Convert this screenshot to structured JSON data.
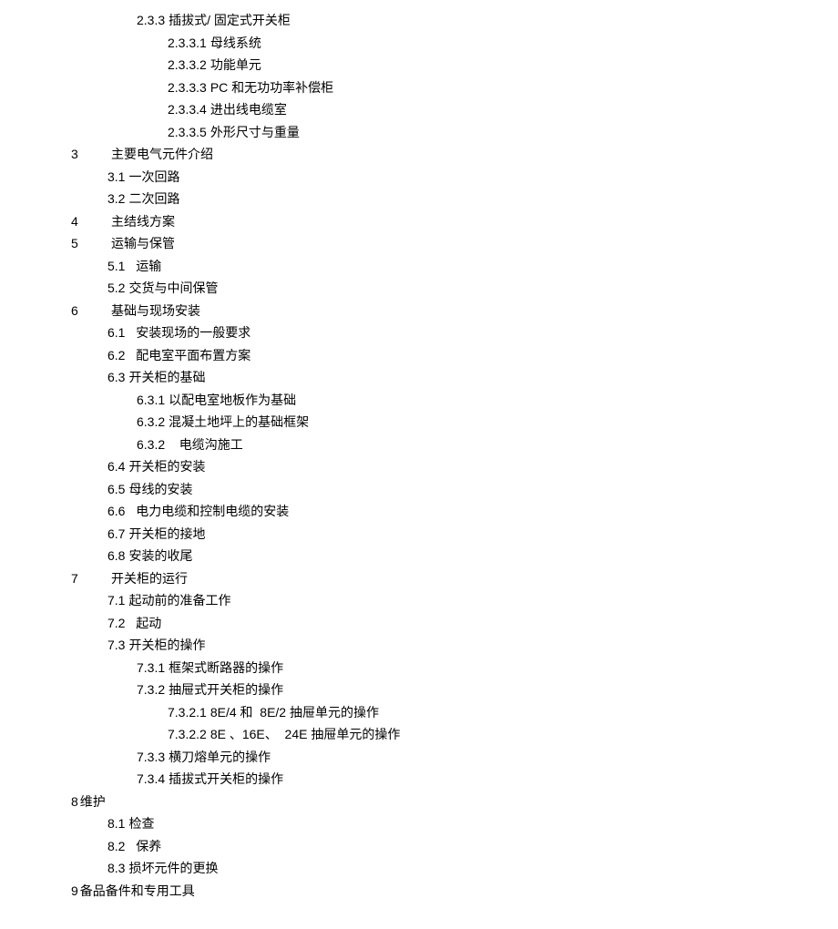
{
  "toc": [
    {
      "level": 3,
      "num": "2.3.3",
      "title": "插拔式/ 固定式开关柜"
    },
    {
      "level": 4,
      "num": "2.3.3.1",
      "title": "母线系统"
    },
    {
      "level": 4,
      "num": "2.3.3.2",
      "title": "功能单元"
    },
    {
      "level": 4,
      "num": "2.3.3.3",
      "title": "PC 和无功功率补偿柜"
    },
    {
      "level": 4,
      "num": "2.3.3.4",
      "title": "进出线电缆室"
    },
    {
      "level": 4,
      "num": "2.3.3.5",
      "title": "外形尺寸与重量"
    },
    {
      "level": 1,
      "num": "3",
      "title": "主要电气元件介绍",
      "sp": "sp1"
    },
    {
      "level": 2,
      "num": "3.1",
      "title": "一次回路"
    },
    {
      "level": 2,
      "num": "3.2",
      "title": "二次回路"
    },
    {
      "level": 1,
      "num": "4",
      "title": "主结线方案",
      "sp": "sp1"
    },
    {
      "level": 1,
      "num": "5",
      "title": "运输与保管",
      "sp": "sp1"
    },
    {
      "level": 2,
      "num": "5.1",
      "title": "  运输"
    },
    {
      "level": 2,
      "num": "5.2",
      "title": "交货与中间保管"
    },
    {
      "level": 1,
      "num": "6",
      "title": "基础与现场安装",
      "sp": "sp1"
    },
    {
      "level": 2,
      "num": "6.1",
      "title": "  安装现场的一般要求"
    },
    {
      "level": 2,
      "num": "6.2",
      "title": "  配电室平面布置方案"
    },
    {
      "level": 2,
      "num": "6.3",
      "title": "开关柜的基础"
    },
    {
      "level": 3,
      "num": "6.3.1",
      "title": "以配电室地板作为基础"
    },
    {
      "level": 3,
      "num": "6.3.2",
      "title": "混凝土地坪上的基础框架"
    },
    {
      "level": 3,
      "num": "6.3.2",
      "title": "   电缆沟施工"
    },
    {
      "level": 2,
      "num": "6.4",
      "title": "开关柜的安装"
    },
    {
      "level": 2,
      "num": "6.5",
      "title": "母线的安装"
    },
    {
      "level": 2,
      "num": "6.6",
      "title": "  电力电缆和控制电缆的安装"
    },
    {
      "level": 2,
      "num": "6.7",
      "title": "开关柜的接地"
    },
    {
      "level": 2,
      "num": "6.8",
      "title": "安装的收尾"
    },
    {
      "level": 1,
      "num": "7",
      "title": "开关柜的运行",
      "sp": "sp1"
    },
    {
      "level": 2,
      "num": "7.1",
      "title": "起动前的准备工作"
    },
    {
      "level": 2,
      "num": "7.2",
      "title": "  起动"
    },
    {
      "level": 2,
      "num": "7.3",
      "title": "开关柜的操作"
    },
    {
      "level": 3,
      "num": "7.3.1",
      "title": "框架式断路器的操作"
    },
    {
      "level": 3,
      "num": "7.3.2",
      "title": "抽屉式开关柜的操作"
    },
    {
      "level": 4,
      "num": "7.3.2.1",
      "title": "8E/4 和  8E/2 抽屉单元的操作"
    },
    {
      "level": 4,
      "num": "7.3.2.2",
      "title": "8E 、16E、  24E 抽屉单元的操作"
    },
    {
      "level": 3,
      "num": "7.3.3",
      "title": "横刀熔单元的操作"
    },
    {
      "level": 3,
      "num": "7.3.4",
      "title": "插拔式开关柜的操作"
    },
    {
      "level": 1,
      "num": "8",
      "title": "维护",
      "tight": true
    },
    {
      "level": 2,
      "num": "8.1",
      "title": "检查"
    },
    {
      "level": 2,
      "num": "8.2",
      "title": "  保养"
    },
    {
      "level": 2,
      "num": "8.3",
      "title": "损坏元件的更换"
    },
    {
      "level": 1,
      "num": "9",
      "title": "备品备件和专用工具",
      "tight": true
    }
  ]
}
